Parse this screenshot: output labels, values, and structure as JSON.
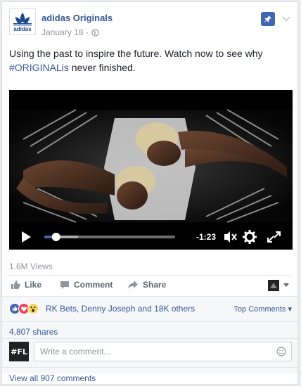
{
  "post": {
    "page_name": "adidas Originals",
    "date": "January 18",
    "dot": "·",
    "text_before": "Using the past to inspire the future. Watch now to see why ",
    "hashtag": "#ORIGINALis",
    "text_after": " never finished.",
    "logo_text": "adidas"
  },
  "video": {
    "time_remaining": "-1:23",
    "progress": 0.09,
    "buffered": 0.26
  },
  "stats": {
    "views": "1.6M Views"
  },
  "actions": {
    "like": "Like",
    "comment": "Comment",
    "share": "Share"
  },
  "reactions": {
    "names": "RK Bets, Denny Joseph and 18K others",
    "top_comments": "Top Comments",
    "top_comments_arrow": "▾",
    "shares": "4,807 shares",
    "view_all": "View all 907 comments"
  },
  "comment_box": {
    "avatar_text": "#FL",
    "placeholder": "Write a comment..."
  },
  "colors": {
    "link": "#365899",
    "brand_blue": "#4267b2",
    "muted": "#90949c"
  }
}
